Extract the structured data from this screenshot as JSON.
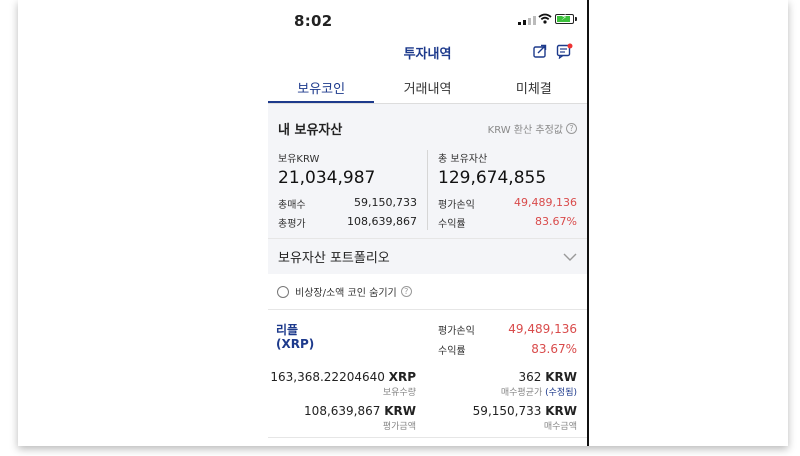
{
  "status": {
    "time": "8:02"
  },
  "header": {
    "title": "투자내역"
  },
  "tabs": [
    {
      "label": "보유코인",
      "active": true
    },
    {
      "label": "거래내역",
      "active": false
    },
    {
      "label": "미체결",
      "active": false
    }
  ],
  "summary": {
    "heading": "내 보유자산",
    "note": "KRW 환산 추정값",
    "krw_label": "보유KRW",
    "krw_value": "21,034,987",
    "total_label": "총 보유자산",
    "total_value": "129,674,855",
    "buy_label": "총매수",
    "buy_value": "59,150,733",
    "eval_label": "총평가",
    "eval_value": "108,639,867",
    "pl_label": "평가손익",
    "pl_value": "49,489,136",
    "rate_label": "수익률",
    "rate_value": "83.67%"
  },
  "portfolio": {
    "label": "보유자산 포트폴리오"
  },
  "hide_option": {
    "label": "비상장/소액 코인 숨기기"
  },
  "coin": {
    "name": "리플",
    "symbol": "(XRP)",
    "pl_label": "평가손익",
    "pl_value": "49,489,136",
    "rate_label": "수익률",
    "rate_value": "83.67%",
    "qty_value": "163,368.22204640",
    "qty_unit": "XRP",
    "qty_label": "보유수량",
    "avg_value": "362",
    "avg_unit": "KRW",
    "avg_label": "매수평균가",
    "avg_edit": "(수정됨)",
    "eval_value": "108,639,867",
    "eval_unit": "KRW",
    "eval_label": "평가금액",
    "buy_value": "59,150,733",
    "buy_unit": "KRW",
    "buy_label": "매수금액"
  },
  "colors": {
    "accent": "#1d3a8c",
    "profit": "#d94b4b"
  }
}
